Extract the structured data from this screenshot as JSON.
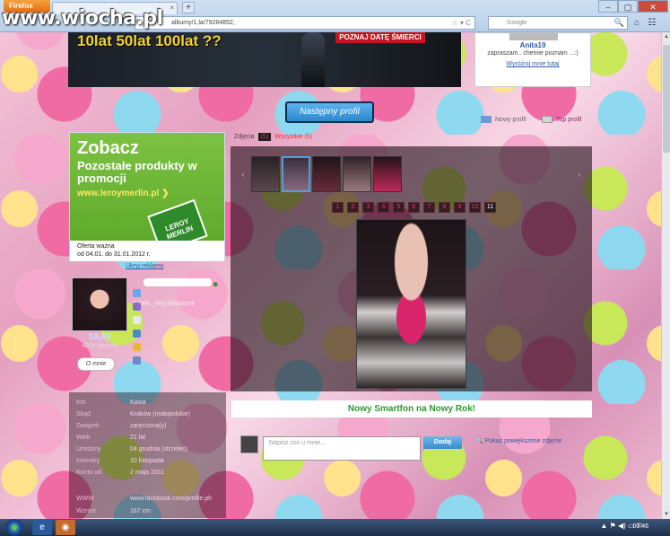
{
  "watermark": "www.wiocha.pl",
  "browser": {
    "app_button": "Firefox",
    "tab_close": "×",
    "new_tab": "+",
    "window_minimize": "–",
    "window_maximize": "▢",
    "window_close": "✕",
    "url": "albumy/1,la/79284852,",
    "search_placeholder": "Google",
    "url_icons": "☆ ▾ C",
    "search_icon": "🔍",
    "home_icon": "⌂",
    "bookmark_icon": "☷"
  },
  "top_banner": {
    "headline": "10lat   50lat    100lat ??",
    "red_label": "POZNAJ DATĘ ŚMIERCI"
  },
  "user_card": {
    "name": "Anita19",
    "text": "zapraszam.. chetnie poznam ...:)",
    "link": "Wyróżnij mnie tutaj"
  },
  "nav": {
    "next_profile": "Następny profil",
    "new_profile": "Nowy profil",
    "top_profile": "Top profil"
  },
  "ad": {
    "headline": "Zobacz",
    "subline": "Pozostałe produkty w promocji",
    "url": "www.leroymerlin.pl",
    "url_arrow": "❯",
    "logo": "LEROY MERLIN",
    "offer_line1": "Oferta ważna",
    "offer_line2": "od 04.01. do 31.01.2012 r.",
    "hide": "Ukryj reklamy"
  },
  "profile": {
    "status": "KAMIL_Mój Misiaczek",
    "score": "10,49",
    "votes": "4264 głosów",
    "about_button": "O mnie",
    "smiley": "☻"
  },
  "info": [
    {
      "label": "Kto",
      "value": "Kasia"
    },
    {
      "label": "Skąd",
      "value": "Kraków (małopolskie)"
    },
    {
      "label": "Związek",
      "value": "zaręczona(y)"
    },
    {
      "label": "Wiek",
      "value": "21 lat"
    },
    {
      "label": "Urodziny",
      "value": "04 grudnia (strzelec)"
    },
    {
      "label": "Imieniny",
      "value": "10 listopada"
    },
    {
      "label": "Konto od",
      "value": "2 maja 2011"
    },
    {
      "label": "WWW",
      "value": "www.facebook.com/profile.ph"
    },
    {
      "label": "Wzrost",
      "value": "167 cm"
    }
  ],
  "gallery": {
    "tab_label": "Zdjęcia",
    "count": "(5)",
    "other_tab": "Wszystkie (5)",
    "prev_arrow": "‹",
    "next_arrow": "›",
    "pages": [
      "1",
      "2",
      "3",
      "4",
      "5",
      "6",
      "7",
      "8",
      "9",
      "10",
      "11"
    ],
    "current_page": "11"
  },
  "promo_text": "Nowy Smartfon na Nowy Rok!",
  "comment": {
    "placeholder": "Napisz coś u mnie...",
    "submit": "Dodaj",
    "enlarge": "Pokaż powiększone zdjęcie"
  },
  "scrollbar": {
    "up": "▲",
    "down": "▼"
  },
  "taskbar": {
    "ie_icon": "e",
    "firefox_icon": "◉",
    "tray_icons": "▲  ⚑  ◀)  ▭  ⚐",
    "clock": "00:46"
  }
}
